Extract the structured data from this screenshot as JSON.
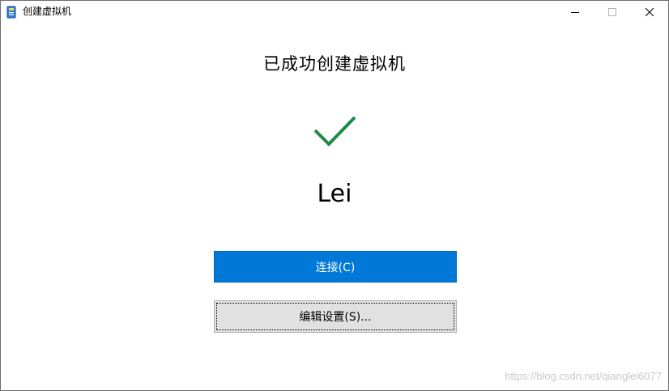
{
  "window": {
    "title": "创建虚拟机",
    "controls": {
      "minimize": "—",
      "maximize": "☐",
      "close": "✕"
    }
  },
  "main": {
    "heading": "已成功创建虚拟机",
    "vm_name": "Lei",
    "connect_label": "连接(C)",
    "edit_settings_label": "编辑设置(S)..."
  },
  "watermark": "https://blog.csdn.net/qianglei6077",
  "colors": {
    "accent": "#0078d7",
    "check": "#1e8a46"
  }
}
